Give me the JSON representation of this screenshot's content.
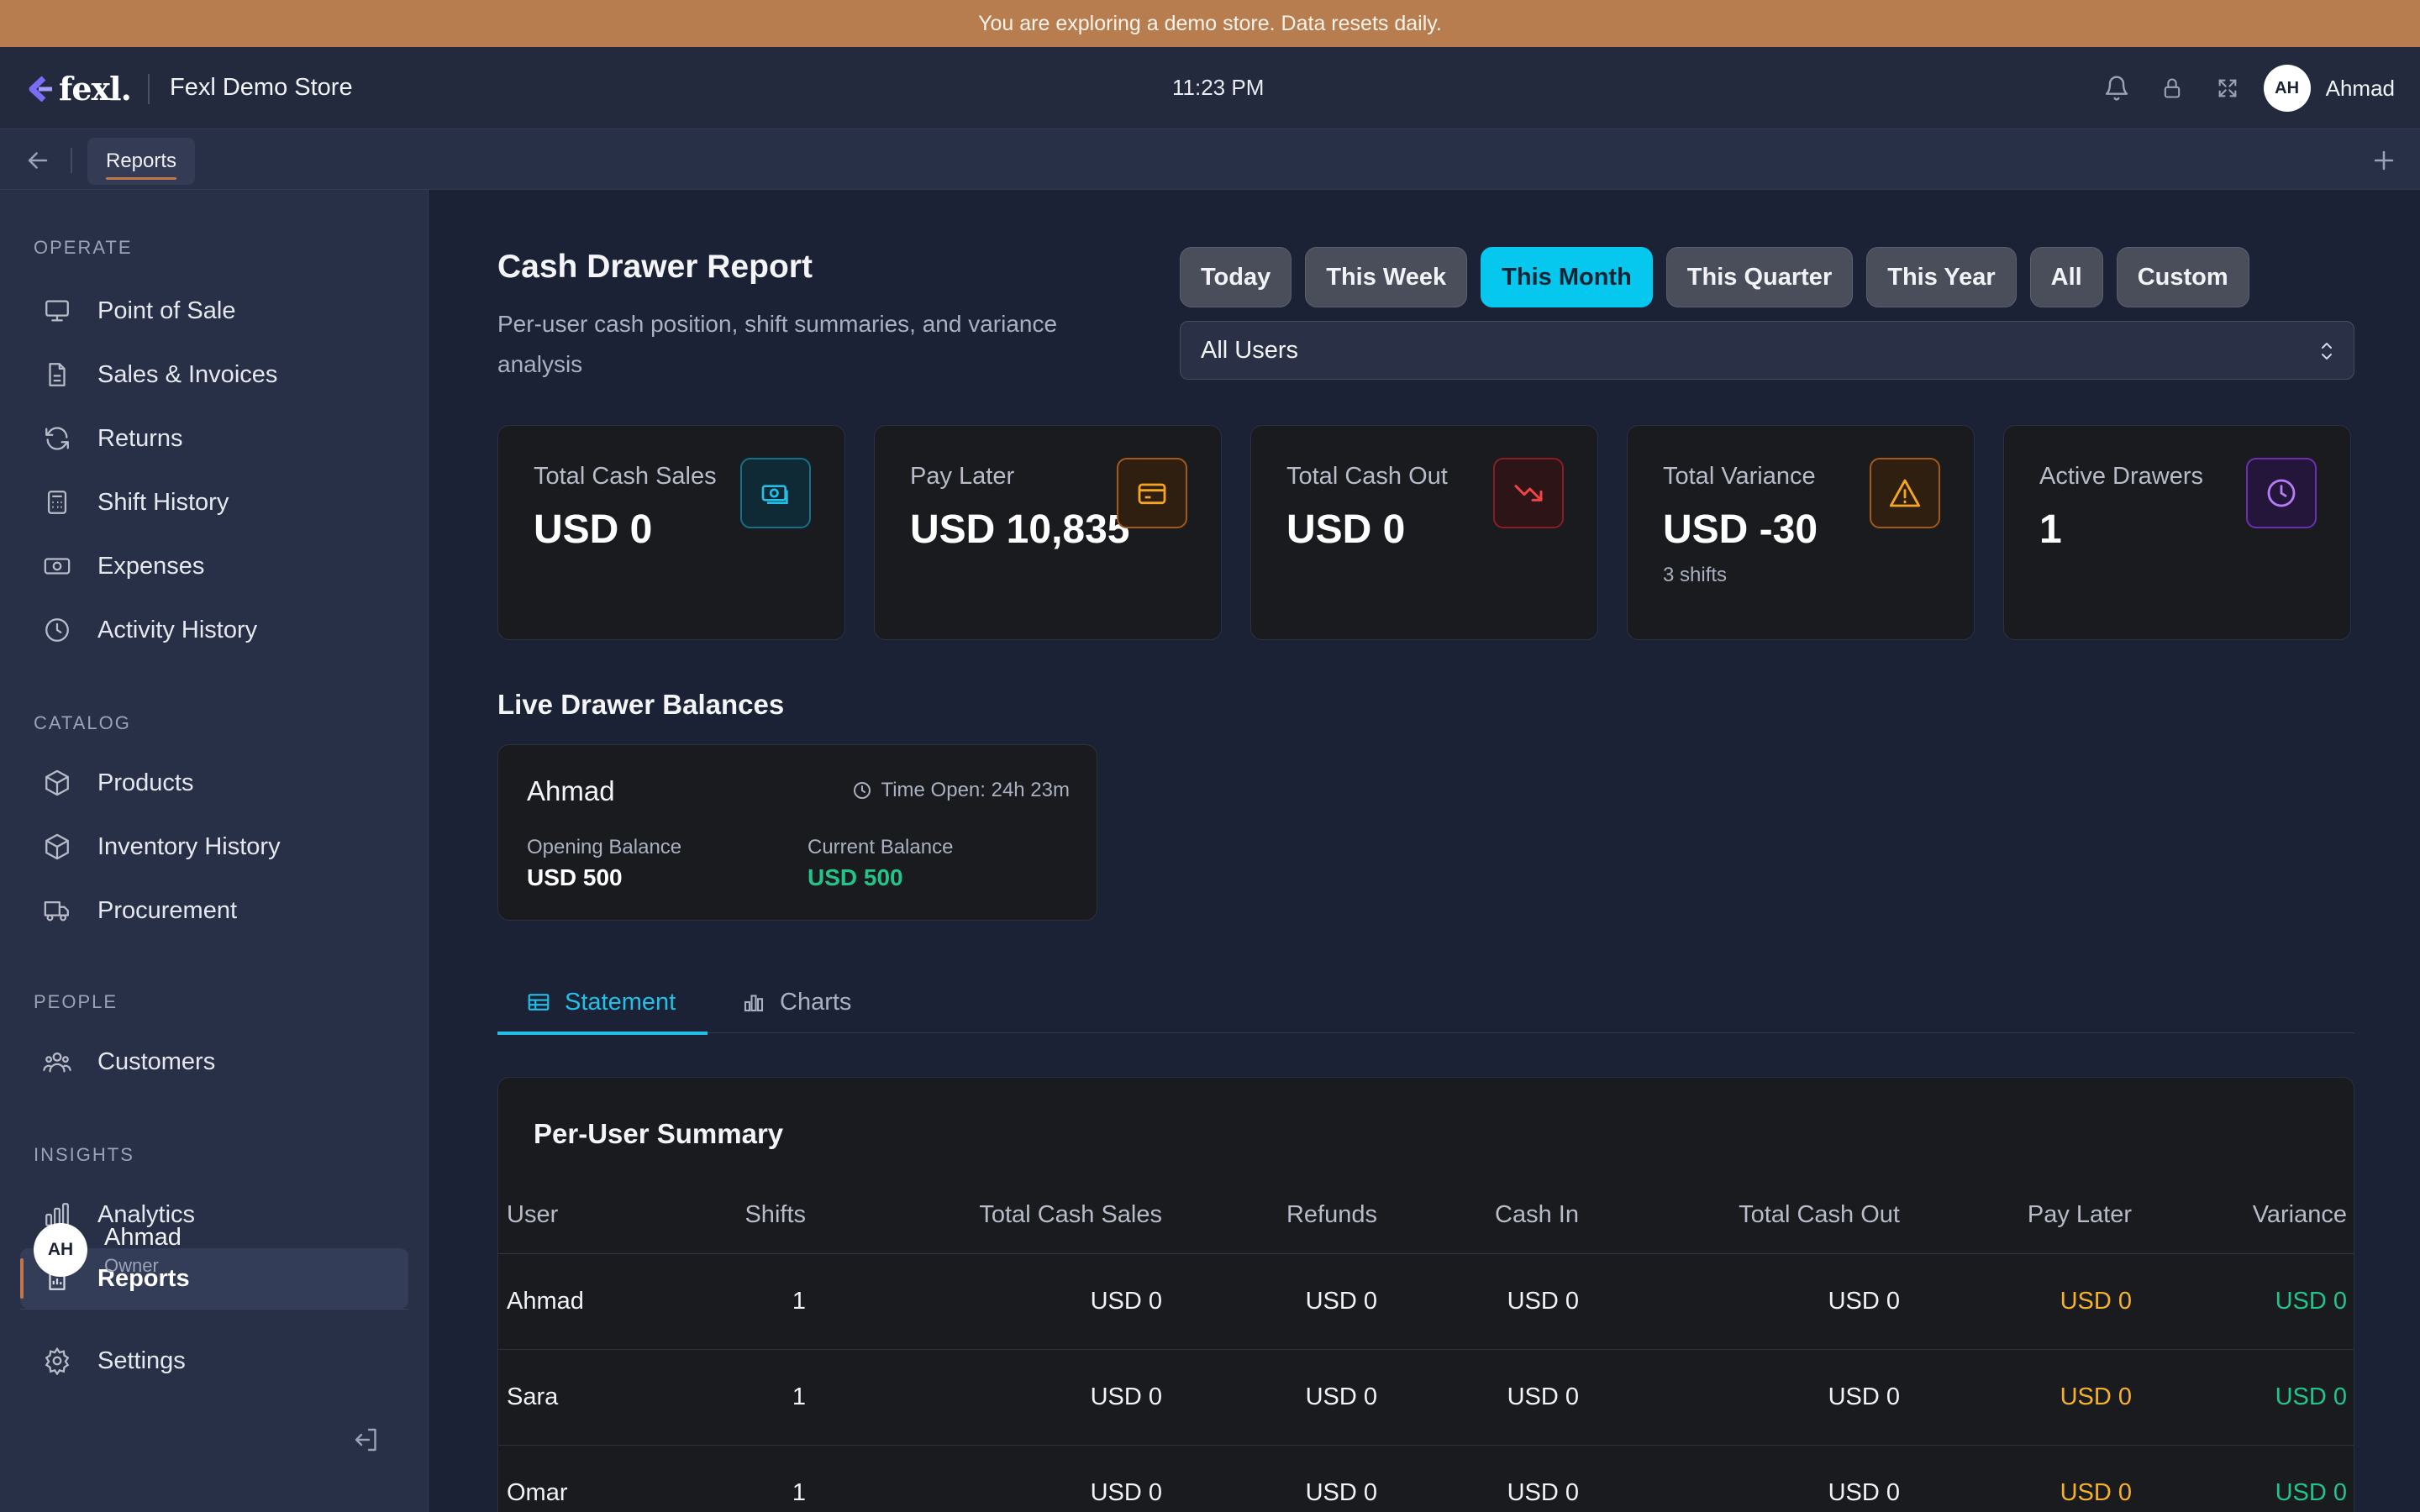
{
  "banner": {
    "text": "You are exploring a demo store. Data resets daily."
  },
  "header": {
    "logo_text": "fexl.",
    "store_name": "Fexl Demo Store",
    "time": "11:23 PM",
    "user_initials": "AH",
    "user_name": "Ahmad",
    "icons": [
      "bell-icon",
      "lock-icon",
      "fullscreen-icon"
    ]
  },
  "tabstrip": {
    "active_tab": "Reports"
  },
  "sidebar": {
    "sections": [
      {
        "title": "OPERATE",
        "items": [
          {
            "label": "Point of Sale",
            "icon": "monitor-icon"
          },
          {
            "label": "Sales & Invoices",
            "icon": "document-icon"
          },
          {
            "label": "Returns",
            "icon": "refresh-icon"
          },
          {
            "label": "Shift History",
            "icon": "calculator-icon"
          },
          {
            "label": "Expenses",
            "icon": "banknote-icon"
          },
          {
            "label": "Activity History",
            "icon": "clock-icon"
          }
        ]
      },
      {
        "title": "CATALOG",
        "items": [
          {
            "label": "Products",
            "icon": "box-icon"
          },
          {
            "label": "Inventory History",
            "icon": "box-icon"
          },
          {
            "label": "Procurement",
            "icon": "truck-icon"
          }
        ]
      },
      {
        "title": "PEOPLE",
        "items": [
          {
            "label": "Customers",
            "icon": "users-icon"
          }
        ]
      },
      {
        "title": "INSIGHTS",
        "items": [
          {
            "label": "Analytics",
            "icon": "bar-chart-icon"
          },
          {
            "label": "Reports",
            "icon": "report-icon",
            "active": true
          }
        ]
      }
    ],
    "settings_label": "Settings",
    "user": {
      "initials": "AH",
      "name": "Ahmad",
      "role": "Owner"
    }
  },
  "page": {
    "title": "Cash Drawer Report",
    "subtitle": "Per-user cash position, shift summaries, and variance analysis",
    "periods": [
      "Today",
      "This Week",
      "This Month",
      "This Quarter",
      "This Year",
      "All",
      "Custom"
    ],
    "active_period": "This Month",
    "user_filter": "All Users"
  },
  "cards": [
    {
      "label": "Total Cash Sales",
      "value": "USD 0",
      "note": "",
      "icon": "cash-icon",
      "accent": "#13718a"
    },
    {
      "label": "Pay Later",
      "value": "USD 10,835",
      "note": "",
      "icon": "credit-card-icon",
      "accent": "#f59e0b"
    },
    {
      "label": "Total Cash Out",
      "value": "USD 0",
      "note": "",
      "icon": "trending-down-icon",
      "accent": "#ef4444"
    },
    {
      "label": "Total Variance",
      "value": "USD -30",
      "note": "3 shifts",
      "icon": "warning-icon",
      "accent": "#f59e0b"
    },
    {
      "label": "Active Drawers",
      "value": "1",
      "note": "",
      "icon": "clock-icon",
      "accent": "#a855f7"
    }
  ],
  "live": {
    "title": "Live Drawer Balances",
    "drawer": {
      "name": "Ahmad",
      "time_open": "Time Open: 24h 23m",
      "opening_label": "Opening Balance",
      "opening_value": "USD 500",
      "current_label": "Current Balance",
      "current_value": "USD 500"
    }
  },
  "view_tabs": {
    "statement": "Statement",
    "charts": "Charts",
    "active": "Statement"
  },
  "summary": {
    "title": "Per-User Summary",
    "columns": [
      "User",
      "Shifts",
      "Total Cash Sales",
      "Refunds",
      "Cash In",
      "Total Cash Out",
      "Pay Later",
      "Variance"
    ],
    "rows": [
      [
        "Ahmad",
        "1",
        "USD 0",
        "USD 0",
        "USD 0",
        "USD 0",
        "USD 0",
        "USD 0"
      ],
      [
        "Sara",
        "1",
        "USD 0",
        "USD 0",
        "USD 0",
        "USD 0",
        "USD 0",
        "USD 0"
      ],
      [
        "Omar",
        "1",
        "USD 0",
        "USD 0",
        "USD 0",
        "USD 0",
        "USD 0",
        "USD 0"
      ]
    ]
  },
  "colors": {
    "accent": "#06c8ef",
    "banner": "#b87d4f",
    "positive": "#22c488",
    "pay_later": "#f5b12b"
  }
}
